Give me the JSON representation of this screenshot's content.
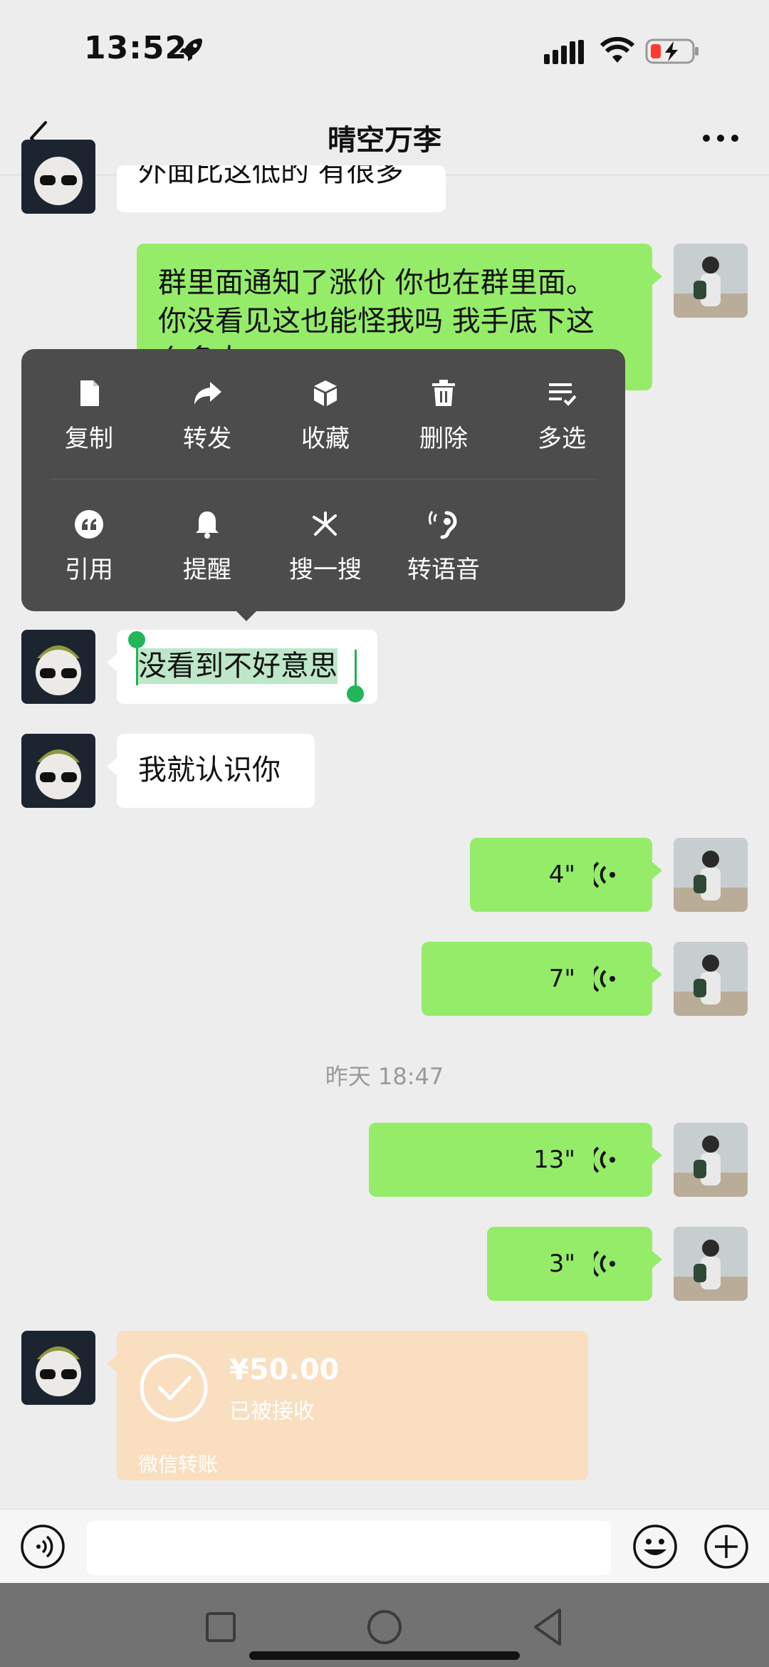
{
  "status_bar": {
    "time": "13:52"
  },
  "header": {
    "title": "晴空万李"
  },
  "messages": {
    "top_partial": "外面比这低的 有很多",
    "long_out_line1": "群里面通知了涨价 你也在群里面。",
    "long_out_line2": "你没看见这也能怪我吗 我手底下这",
    "long_out_line3": "么多人",
    "selected": "没看到不好意思",
    "know_you": "我就认识你",
    "voice1": "4\"",
    "voice2": "7\"",
    "timestamp": "昨天 18:47",
    "voice3": "13\"",
    "voice4": "3\""
  },
  "context_menu": {
    "row1": [
      {
        "label": "复制",
        "icon": "copy-icon"
      },
      {
        "label": "转发",
        "icon": "forward-icon"
      },
      {
        "label": "收藏",
        "icon": "favorite-icon"
      },
      {
        "label": "删除",
        "icon": "delete-icon"
      },
      {
        "label": "多选",
        "icon": "multi-select-icon"
      }
    ],
    "row2": [
      {
        "label": "引用",
        "icon": "quote-icon"
      },
      {
        "label": "提醒",
        "icon": "remind-icon"
      },
      {
        "label": "搜一搜",
        "icon": "search-search-icon"
      },
      {
        "label": "转语音",
        "icon": "to-voice-icon"
      }
    ]
  },
  "transfer": {
    "amount": "¥50.00",
    "status": "已被接收",
    "footer": "微信转账"
  },
  "colors": {
    "outgoing_bubble": "#95ec69",
    "incoming_bubble": "#ffffff",
    "menu_bg": "#4c4c4c",
    "transfer_bg": "#f9dfc0",
    "selection": "#22b55a"
  }
}
